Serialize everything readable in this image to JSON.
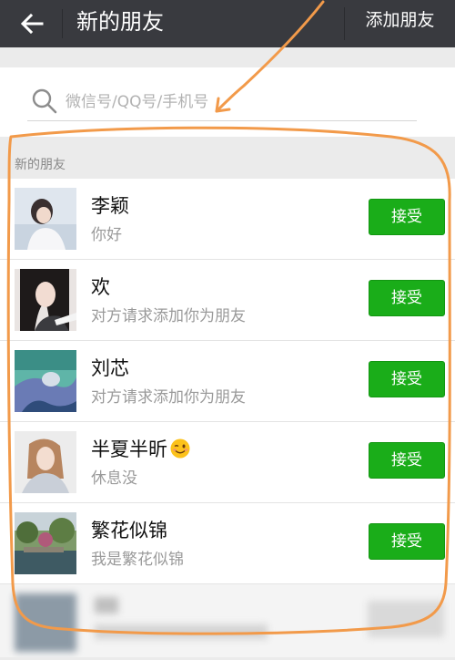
{
  "header": {
    "title": "新的朋友",
    "action_label": "添加朋友"
  },
  "search": {
    "placeholder": "微信号/QQ号/手机号"
  },
  "section": {
    "title": "新的朋友"
  },
  "requests": [
    {
      "name": "李颖",
      "message": "你好",
      "button": "接受",
      "avatar": "avatar-photo-1"
    },
    {
      "name": "欢",
      "message": "对方请求添加你为朋友",
      "button": "接受",
      "avatar": "avatar-photo-2"
    },
    {
      "name": "刘芯",
      "message": "对方请求添加你为朋友",
      "button": "接受",
      "avatar": "avatar-photo-3"
    },
    {
      "name": "半夏半昕",
      "message": "休息没",
      "button": "接受",
      "avatar": "avatar-photo-4",
      "emoji": "winking-face-emoji"
    },
    {
      "name": "繁花似锦",
      "message": "我是繁花似锦",
      "button": "接受",
      "avatar": "avatar-photo-5"
    }
  ],
  "colors": {
    "header_bg": "#393a3f",
    "accept_green": "#1aad19",
    "annotation_orange": "#f29a4a"
  }
}
